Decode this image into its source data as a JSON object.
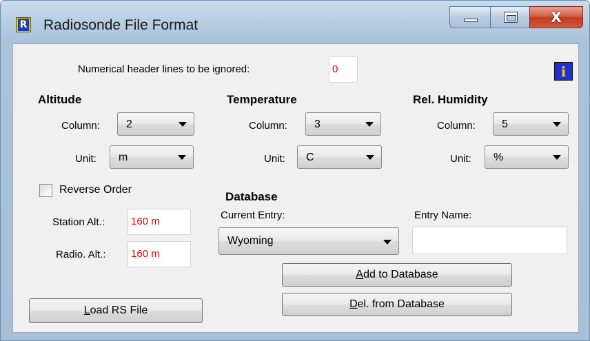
{
  "window": {
    "title": "Radiosonde File Format",
    "icon_letter": "R",
    "controls": [
      "minimize-icon",
      "maximize-icon",
      "close-icon"
    ],
    "close_glyph": "X"
  },
  "header": {
    "ignore_label": "Numerical header lines to be ignored:",
    "ignore_value": "0"
  },
  "altitude": {
    "title": "Altitude",
    "column_label": "Column:",
    "column_value": "2",
    "unit_label": "Unit:",
    "unit_value": "m"
  },
  "temperature": {
    "title": "Temperature",
    "column_label": "Column:",
    "column_value": "3",
    "unit_label": "Unit:",
    "unit_value": "C"
  },
  "humidity": {
    "title": "Rel. Humidity",
    "column_label": "Column:",
    "column_value": "5",
    "unit_label": "Unit:",
    "unit_value": "%"
  },
  "options": {
    "reverse_order_label": "Reverse Order",
    "reverse_order_checked": false,
    "station_alt_label": "Station Alt.:",
    "station_alt_value": "160 m",
    "radio_alt_label": "Radio. Alt.:",
    "radio_alt_value": "160 m"
  },
  "database": {
    "title": "Database",
    "current_entry_label": "Current Entry:",
    "current_entry_value": "Wyoming",
    "entry_name_label": "Entry Name:",
    "entry_name_value": "",
    "add_button": {
      "underlined": "A",
      "rest": "dd to Database"
    },
    "del_button": {
      "underlined": "D",
      "rest": "el. from Database"
    }
  },
  "load_button": {
    "underlined": "L",
    "rest": "oad RS File"
  },
  "info_icon_glyph": "i",
  "colors": {
    "value_red": "#e00000",
    "info_blue": "#1f2fd6",
    "info_yellow": "#ffcc00"
  }
}
